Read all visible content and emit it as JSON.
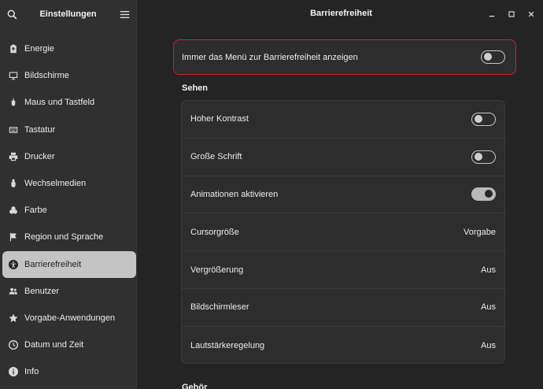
{
  "sidebar": {
    "title": "Einstellungen",
    "items": [
      {
        "label": "Energie",
        "icon": "battery-icon"
      },
      {
        "label": "Bildschirme",
        "icon": "monitor-icon"
      },
      {
        "label": "Maus und Tastfeld",
        "icon": "mouse-icon"
      },
      {
        "label": "Tastatur",
        "icon": "keyboard-icon"
      },
      {
        "label": "Drucker",
        "icon": "printer-icon"
      },
      {
        "label": "Wechselmedien",
        "icon": "usb-icon"
      },
      {
        "label": "Farbe",
        "icon": "color-icon"
      },
      {
        "label": "Region und Sprache",
        "icon": "flag-icon"
      },
      {
        "label": "Barrierefreiheit",
        "icon": "accessibility-icon",
        "selected": true
      },
      {
        "label": "Benutzer",
        "icon": "users-icon"
      },
      {
        "label": "Vorgabe-Anwendungen",
        "icon": "star-icon"
      },
      {
        "label": "Datum und Zeit",
        "icon": "clock-icon"
      },
      {
        "label": "Info",
        "icon": "info-icon"
      }
    ]
  },
  "main": {
    "title": "Barrierefreiheit",
    "top_option": {
      "label": "Immer das Menü zur Barrierefreiheit anzeigen",
      "on": false
    },
    "section_sehen": "Sehen",
    "section_next": "Gehör",
    "rows": [
      {
        "label": "Hoher Kontrast",
        "type": "switch",
        "on": false
      },
      {
        "label": "Große Schrift",
        "type": "switch",
        "on": false
      },
      {
        "label": "Animationen aktivieren",
        "type": "switch",
        "on": true
      },
      {
        "label": "Cursorgröße",
        "type": "value",
        "value": "Vorgabe"
      },
      {
        "label": "Vergrößerung",
        "type": "value",
        "value": "Aus"
      },
      {
        "label": "Bildschirmleser",
        "type": "value",
        "value": "Aus"
      },
      {
        "label": "Lautstärkeregelung",
        "type": "value",
        "value": "Aus"
      }
    ]
  },
  "colors": {
    "highlight_border": "#d0212b",
    "sidebar_bg": "#303030",
    "main_bg": "#242424",
    "selected_bg": "#c4c4c4"
  }
}
